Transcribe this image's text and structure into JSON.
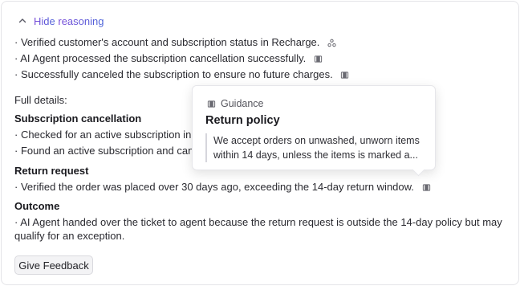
{
  "toggle": {
    "label_part1": "Hide",
    "label_part2": "reasoning",
    "icon": "chevron-up-icon"
  },
  "summary": [
    {
      "text": "· Verified customer's account and subscription status in Recharge.",
      "icon": "integration-icon"
    },
    {
      "text": "· AI Agent processed the subscription cancellation successfully.",
      "icon": "guidance-book-icon"
    },
    {
      "text": "· Successfully canceled the subscription to ensure no future charges.",
      "icon": "guidance-book-icon"
    }
  ],
  "full_details_label": "Full details:",
  "sections": {
    "subscription": {
      "title": "Subscription cancellation",
      "line1": "· Checked for an active subscription in R",
      "line2": "· Found an active subscription and canc"
    },
    "return": {
      "title": "Return request",
      "line1": "· Verified the order was placed over 30 days ago, exceeding the 14-day return window."
    },
    "outcome": {
      "title": "Outcome",
      "line1": "· AI Agent handed over the ticket to agent because the return request is outside the 14-day policy but may",
      "line2": "qualify for an exception."
    }
  },
  "feedback_button": "Give Feedback",
  "tooltip": {
    "kicker": "Guidance",
    "title": "Return policy",
    "body_line1": "We accept orders on unwashed, unworn items",
    "body_line2": "within 14 days, unless the items is marked a..."
  },
  "colors": {
    "accent_start": "#7a4ad8",
    "accent_end": "#4a63d8",
    "border": "#e4e4e8"
  }
}
